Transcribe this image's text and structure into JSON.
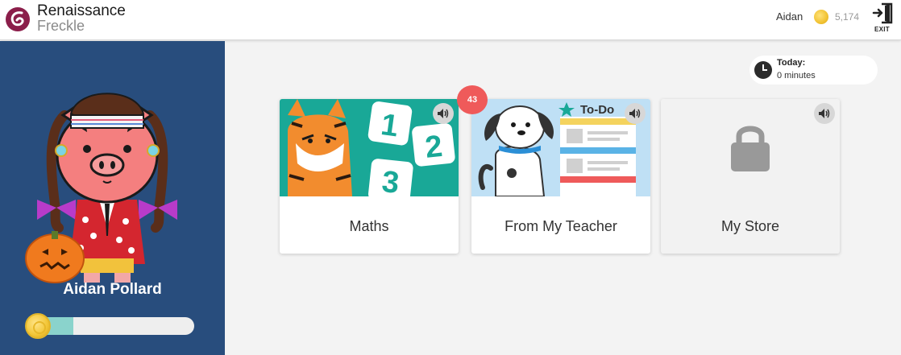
{
  "header": {
    "brand_line1": "Renaissance",
    "brand_line2": "Freckle",
    "user_name": "Aidan",
    "coins": "5,174",
    "exit_label": "EXIT"
  },
  "sidebar": {
    "student_name": "Aidan Pollard",
    "progress_fraction": 0.28
  },
  "today": {
    "label": "Today:",
    "value": "0 minutes"
  },
  "cards": [
    {
      "title": "Maths",
      "image_numbers": [
        "1",
        "2",
        "3"
      ]
    },
    {
      "title": "From My Teacher",
      "image_text": "To-Do",
      "badge": "43"
    },
    {
      "title": "My Store"
    }
  ],
  "colors": {
    "sidebar": "#284d7d",
    "maths_teal": "#19a897",
    "badge": "#ef5a5a",
    "progress_fill": "#8ad3cc"
  }
}
